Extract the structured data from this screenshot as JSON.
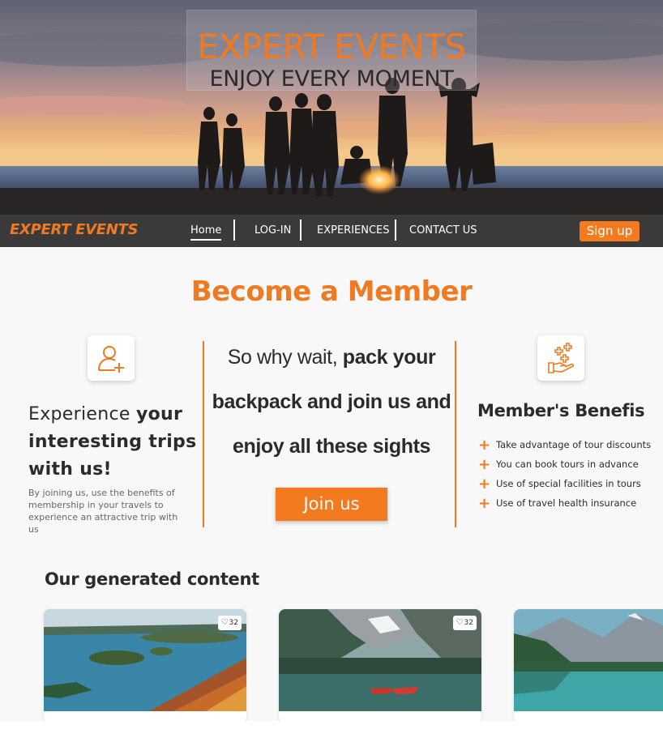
{
  "hero": {
    "title": "EXPERT EVENTS",
    "subtitle": "ENJOY EVERY MOMENT"
  },
  "nav": {
    "brand": "EXPERT EVENTS",
    "links": [
      "Home",
      "LOG-IN",
      "EXPERIENCES",
      "CONTACT US"
    ],
    "active": "Home",
    "signup_label": "Sign up"
  },
  "member": {
    "title": "Become a Member",
    "left": {
      "icon": "add-user-icon",
      "title_plain_1": "Experience ",
      "title_bold_1": "your",
      "title_bold_2": "interesting trips",
      "title_bold_3": "with us!",
      "description": "By joining us, use the benefits of membership in your travels to experience an attractive trip with us"
    },
    "center": {
      "line1_plain": "So why wait, ",
      "line1_bold": "pack your",
      "line2_bold": "backpack and join us and",
      "line3_bold": "enjoy all these sights",
      "join_label": "Join us"
    },
    "right": {
      "icon": "hand-plus-icon",
      "title": "Member's Benefis",
      "benefits": [
        "Take advantage of tour discounts",
        "You can book tours in advance",
        "Use of special facilities in tours",
        "Use of travel health insurance"
      ]
    }
  },
  "content": {
    "title": "Our generated content",
    "cards": [
      {
        "image": "autumn-lake-islands",
        "likes": "32"
      },
      {
        "image": "mountain-lake-red-canoes",
        "likes": "32"
      },
      {
        "image": "mountain-lake-reflection",
        "likes": ""
      }
    ]
  },
  "colors": {
    "accent": "#f07a22",
    "nav_bg": "#3a3a3a",
    "text": "#2b2b2b"
  }
}
